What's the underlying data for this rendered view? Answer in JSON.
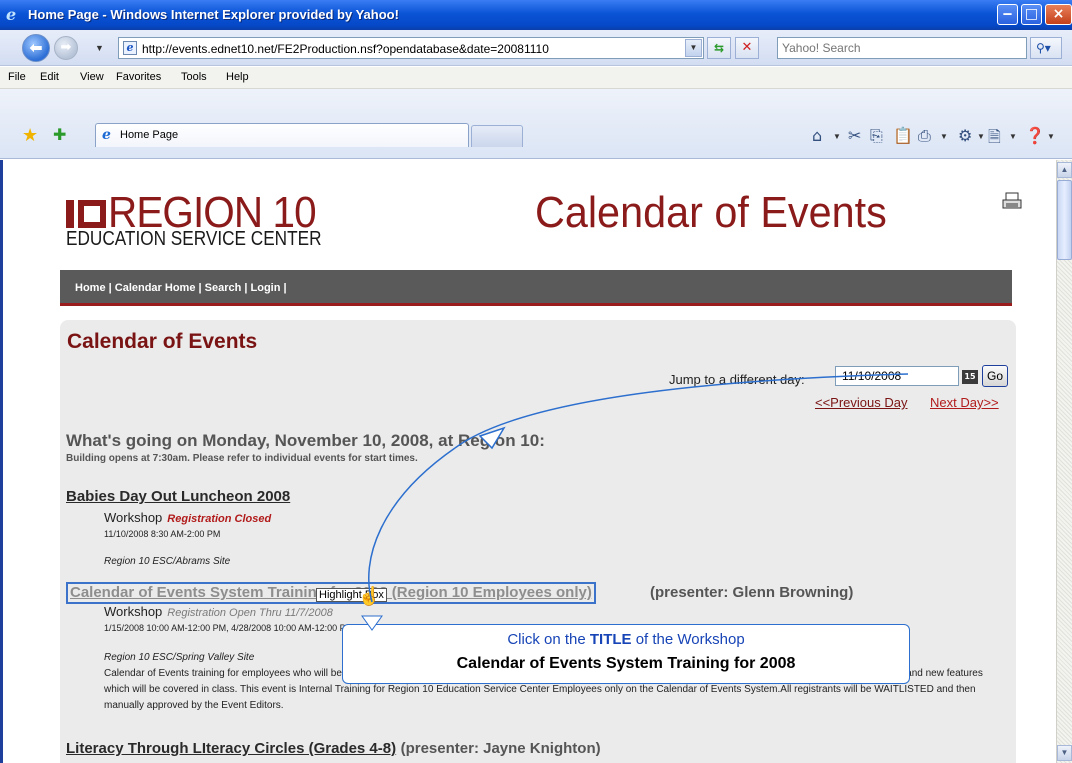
{
  "window": {
    "title": "Home Page - Windows Internet Explorer provided by Yahoo!",
    "ie_icon": "e"
  },
  "address_bar": {
    "url": "http://events.ednet10.net/FE2Production.nsf?opendatabase&date=20081110",
    "search_placeholder": "Yahoo! Search"
  },
  "menu": [
    "File",
    "Edit",
    "View",
    "Favorites",
    "Tools",
    "Help"
  ],
  "tabs": [
    {
      "label": "Home Page"
    }
  ],
  "site": {
    "logo_region": "REGION 10",
    "logo_subtitle": "EDUCATION SERVICE CENTER",
    "title": "Calendar of Events",
    "nav": "Home | Calendar Home | Search | Login |"
  },
  "panel": {
    "title": "Calendar of Events",
    "jump_label": "Jump to a different day:",
    "date_value": "11/10/2008",
    "cal_icon": "15",
    "go_label": "Go",
    "prev_day": "<<Previous Day",
    "next_day": "Next Day>>",
    "day_heading": "What's going on Monday, November 10, 2008, at Region 10:",
    "day_note": "Building opens at 7:30am. Please refer to individual events for start times."
  },
  "events": [
    {
      "title": "Babies Day Out Luncheon 2008",
      "type": "Workshop",
      "status": "Registration Closed",
      "dates": "11/10/2008 8:30 AM-2:00 PM",
      "site": "Region 10 ESC/Abrams Site"
    },
    {
      "title": "Calendar of Events System Training for 2008 (Region 10 Employees only)",
      "presenter": "(presenter: Glenn Browning)",
      "type": "Workshop",
      "status": "Registration Open Thru 11/7/2008",
      "dates": "1/15/2008 10:00 AM-12:00 PM, 4/28/2008 10:00 AM-12:00 PM",
      "site": "Region 10 ESC/Spring Valley Site",
      "description": "Calendar of Events training for employees who will be responsible for posting and managing events on the Region 10 Calendar of Events. Handouts will be provided listing upgrades and new features which will be covered in class. This event is Internal Training for Region 10 Education Service Center Employees only on the Calendar of Events System.All registrants will be WAITLISTED and then manually approved by the Event Editors."
    },
    {
      "title": "Literacy Through LIteracy Circles (Grades 4-8)",
      "presenter": "(presenter: Jayne Knighton)"
    }
  ],
  "tooltip": "Highlight Box",
  "callout": {
    "line1_pre": "Click on the ",
    "line1_em": "TITLE",
    "line1_post": " of the Workshop",
    "line2": "Calendar of Events System Training for 2008"
  },
  "colors": {
    "brand_red": "#8b1a1a",
    "nav_gray": "#5a5a5a",
    "callout_blue": "#1744b6",
    "titlebar_blue": "#0a54d6"
  }
}
